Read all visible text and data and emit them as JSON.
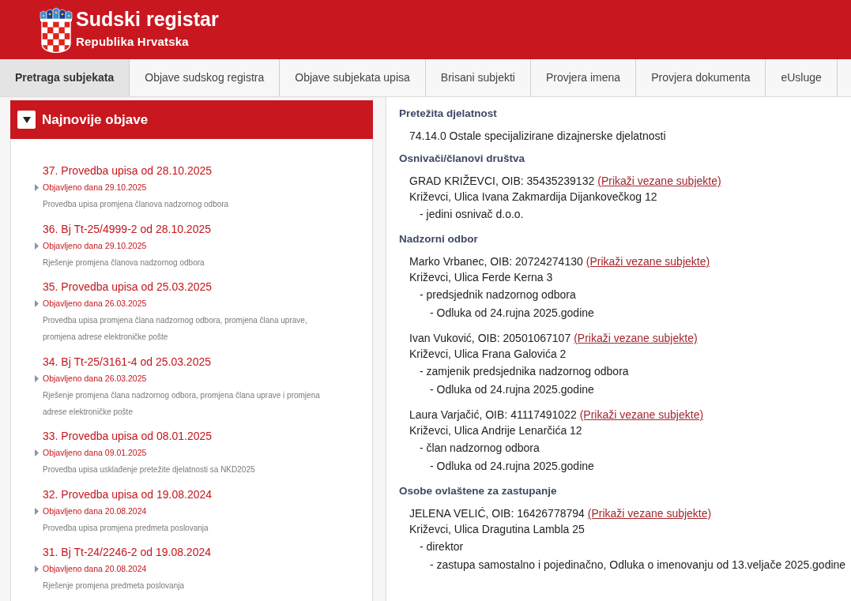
{
  "header": {
    "title": "Sudski registar",
    "subtitle": "Republika Hrvatska"
  },
  "tabs": [
    {
      "label": "Pretraga subjekata",
      "selected": true
    },
    {
      "label": "Objave sudskog registra",
      "selected": false
    },
    {
      "label": "Objave subjekata upisa",
      "selected": false
    },
    {
      "label": "Brisani subjekti",
      "selected": false
    },
    {
      "label": "Provjera imena",
      "selected": false
    },
    {
      "label": "Provjera dokumenta",
      "selected": false
    },
    {
      "label": "eUsluge",
      "selected": false
    }
  ],
  "news_panel": {
    "title": "Najnovije objave",
    "expanded": true,
    "items": [
      {
        "title": "37. Provedba upisa od 28.10.2025",
        "published": "Objavljeno dana 29.10.2025",
        "description": "Provedba upisa promjena članova nadzornog odbora"
      },
      {
        "title": "36. Bj Tt-25/4999-2 od 28.10.2025",
        "published": "Objavljeno dana 29.10.2025",
        "description": "Rješenje promjena članova nadzornog odbora"
      },
      {
        "title": "35. Provedba upisa od 25.03.2025",
        "published": "Objavljeno dana 26.03.2025",
        "description": "Provedba upisa promjena člana nadzornog odbora, promjena člana uprave, promjena adrese elektroničke pošte"
      },
      {
        "title": "34. Bj Tt-25/3161-4 od 25.03.2025",
        "published": "Objavljeno dana 26.03.2025",
        "description": "Rješenje promjena člana nadzornog odbora, promjena člana uprave i promjena adrese elektroničke pošte"
      },
      {
        "title": "33. Provedba upisa od 08.01.2025",
        "published": "Objavljeno dana 09.01.2025",
        "description": "Provedba upisa usklađenje pretežite djelatnosti sa NKD2025"
      },
      {
        "title": "32. Provedba upisa od 19.08.2024",
        "published": "Objavljeno dana 20.08.2024",
        "description": "Provedba upisa promjena predmeta poslovanja"
      },
      {
        "title": "31. Bj Tt-24/2246-2 od 19.08.2024",
        "published": "Objavljeno dana 20.08.2024",
        "description": "Rješenje promjena predmeta poslovanja"
      }
    ]
  },
  "details": {
    "sections": [
      {
        "heading": "Pretežita djelatnost",
        "entries": [
          {
            "kind": "text",
            "text": "74.14.0 Ostale specijalizirane dizajnerske djelatnosti"
          }
        ]
      },
      {
        "heading": "Osnivači/članovi društva",
        "entries": [
          {
            "kind": "person",
            "name": "GRAD KRIŽEVCI, OIB: 35435239132",
            "link": "(Prikaži vezane subjekte)",
            "address": "Križevci, Ulica Ivana Zakmardija Dijankovečkog 12",
            "roles": [
              {
                "text": "- jedini osnivač d.o.o."
              }
            ]
          }
        ]
      },
      {
        "heading": "Nadzorni odbor",
        "entries": [
          {
            "kind": "person",
            "name": "Marko Vrbanec, OIB: 20724274130",
            "link": "(Prikaži vezane subjekte)",
            "address": "Križevci, Ulica Ferde Kerna 3",
            "roles": [
              {
                "text": "- predsjednik nadzornog odbora",
                "children": [
                  {
                    "text": "- Odluka od 24.rujna 2025.godine"
                  }
                ]
              }
            ]
          },
          {
            "kind": "person",
            "name": "Ivan Vuković, OIB: 20501067107",
            "link": "(Prikaži vezane subjekte)",
            "address": "Križevci, Ulica Frana Galovića 2",
            "roles": [
              {
                "text": "- zamjenik predsjednika nadzornog odbora",
                "children": [
                  {
                    "text": "- Odluka od 24.rujna 2025.godine"
                  }
                ]
              }
            ]
          },
          {
            "kind": "person",
            "name": "Laura Varjačić, OIB: 41117491022",
            "link": "(Prikaži vezane subjekte)",
            "address": "Križevci, Ulica Andrije Lenarčića 12",
            "roles": [
              {
                "text": "- član nadzornog odbora",
                "children": [
                  {
                    "text": "- Odluka od 24.rujna 2025.godine"
                  }
                ]
              }
            ]
          }
        ]
      },
      {
        "heading": "Osobe ovlaštene za zastupanje",
        "entries": [
          {
            "kind": "person",
            "name": "JELENA VELIĆ, OIB: 16426778794",
            "link": "(Prikaži vezane subjekte)",
            "address": "Križevci, Ulica Dragutina Lambla 25",
            "roles": [
              {
                "text": "- direktor",
                "children": [
                  {
                    "text": "- zastupa samostalno i pojedinačno, Odluka o imenovanju od 13.veljače 2025.godine"
                  }
                ]
              }
            ]
          }
        ]
      }
    ]
  }
}
